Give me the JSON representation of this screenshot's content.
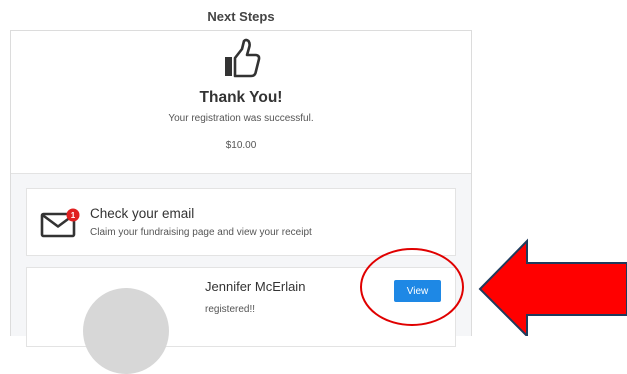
{
  "page": {
    "heading": "Next Steps"
  },
  "confirmation": {
    "title": "Thank You!",
    "message": "Your registration was successful.",
    "amount": "$10.00"
  },
  "email_step": {
    "badge_count": "1",
    "title": "Check your email",
    "description": "Claim your fundraising page and view your receipt"
  },
  "registrant": {
    "name": "Jennifer McErlain",
    "status": "registered!!",
    "view_label": "View"
  },
  "annotations": {
    "circle_color": "#e00000",
    "arrow_color": "#ff0000"
  },
  "colors": {
    "accent": "#1e88e5",
    "badge": "#e02020"
  },
  "icons": [
    "thumbs-up-icon",
    "envelope-icon",
    "notification-badge",
    "avatar-silhouette"
  ]
}
